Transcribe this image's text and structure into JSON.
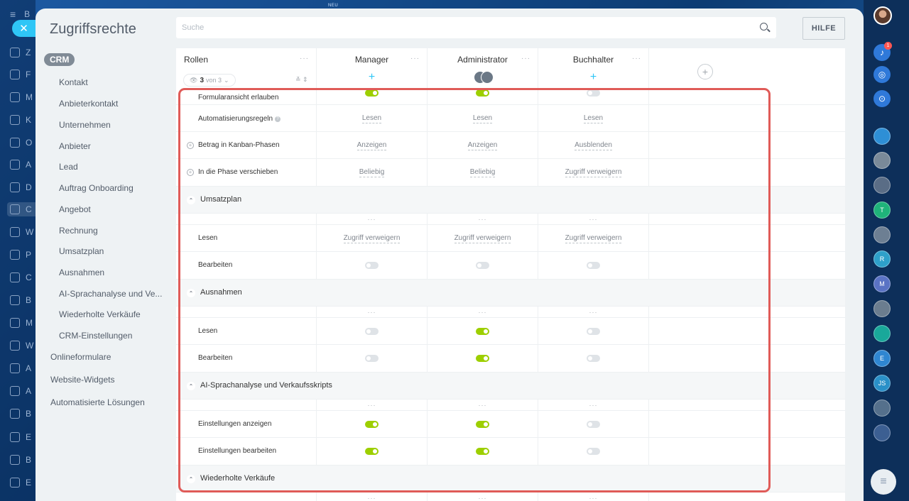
{
  "background": {
    "neu_label": "NEU",
    "left_menu": [
      {
        "initial": "Z"
      },
      {
        "initial": "F"
      },
      {
        "initial": "M"
      },
      {
        "initial": "K"
      },
      {
        "initial": "O"
      },
      {
        "initial": "A"
      },
      {
        "initial": "D"
      },
      {
        "initial": "C"
      },
      {
        "initial": "W"
      },
      {
        "initial": "P"
      },
      {
        "initial": "C"
      },
      {
        "initial": "B"
      },
      {
        "initial": "M"
      },
      {
        "initial": "W"
      },
      {
        "initial": "A"
      },
      {
        "initial": "A"
      },
      {
        "initial": "B"
      },
      {
        "initial": "E"
      },
      {
        "initial": "B"
      },
      {
        "initial": "E"
      }
    ],
    "menu_top_initial": "B",
    "notification_count": "1",
    "rail_avatars": [
      "T",
      "R",
      "M",
      "E",
      "JS"
    ]
  },
  "panel": {
    "title": "Zugriffsrechte",
    "search_placeholder": "Suche",
    "help_label": "HILFE"
  },
  "sidebar": {
    "section_chip": "CRM",
    "sub_items": [
      "Kontakt",
      "Anbieterkontakt",
      "Unternehmen",
      "Anbieter",
      "Lead",
      "Auftrag Onboarding",
      "Angebot",
      "Rechnung",
      "Umsatzplan",
      "Ausnahmen",
      "AI-Sprachanalyse und Ve...",
      "Wiederholte Verkäufe",
      "CRM-Einstellungen"
    ],
    "top_items": [
      "Onlineformulare",
      "Website-Widgets",
      "Automatisierte Lösungen"
    ]
  },
  "table": {
    "roles_title": "Rollen",
    "roles_count": "3",
    "roles_of": "von 3",
    "columns": [
      "Manager",
      "Administrator",
      "Buchhalter"
    ],
    "rows": {
      "form_view": {
        "label": "Formularansicht erlauben",
        "values": [
          "on",
          "on",
          "off"
        ]
      },
      "automation": {
        "label": "Automatisierungsregeln",
        "values": [
          "Lesen",
          "Lesen",
          "Lesen"
        ]
      },
      "kanban_sum": {
        "label": "Betrag in Kanban-Phasen",
        "values": [
          "Anzeigen",
          "Anzeigen",
          "Ausblenden"
        ]
      },
      "move_phase": {
        "label": "In die Phase verschieben",
        "values": [
          "Beliebig",
          "Beliebig",
          "Zugriff verweigern"
        ]
      }
    },
    "sections": {
      "umsatzplan": {
        "title": "Umsatzplan",
        "read": {
          "label": "Lesen",
          "values": [
            "Zugriff verweigern",
            "Zugriff verweigern",
            "Zugriff verweigern"
          ]
        },
        "edit": {
          "label": "Bearbeiten",
          "values": [
            "off",
            "off",
            "off"
          ]
        }
      },
      "ausnahmen": {
        "title": "Ausnahmen",
        "read": {
          "label": "Lesen",
          "values": [
            "off",
            "on",
            "off"
          ]
        },
        "edit": {
          "label": "Bearbeiten",
          "values": [
            "off",
            "on",
            "off"
          ]
        }
      },
      "ai": {
        "title": "AI-Sprachanalyse und Verkaufsskripts",
        "view": {
          "label": "Einstellungen anzeigen",
          "values": [
            "on",
            "on",
            "off"
          ]
        },
        "edit": {
          "label": "Einstellungen bearbeiten",
          "values": [
            "on",
            "on",
            "off"
          ]
        }
      },
      "wiederholte": {
        "title": "Wiederholte Verkäufe"
      }
    }
  },
  "colors": {
    "toggle_on": "#9dcf00",
    "toggle_off": "#dfe3e7",
    "accent": "#2fc6f6",
    "highlight": "#e05b58"
  }
}
